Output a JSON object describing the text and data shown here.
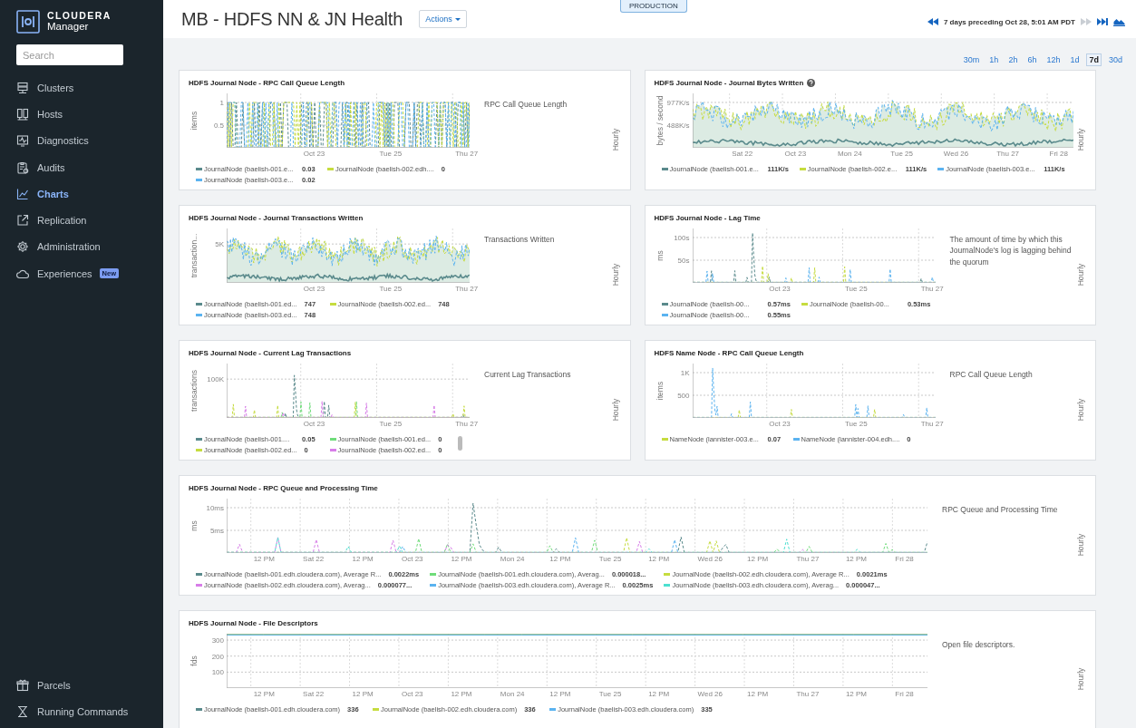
{
  "sidebar": {
    "logo": {
      "brand": "CLOUDERA",
      "product": "Manager"
    },
    "search": {
      "placeholder": "Search"
    },
    "items": [
      {
        "label": "Clusters",
        "selected": false
      },
      {
        "label": "Hosts",
        "selected": false
      },
      {
        "label": "Diagnostics",
        "selected": false
      },
      {
        "label": "Audits",
        "selected": false
      },
      {
        "label": "Charts",
        "selected": true
      },
      {
        "label": "Replication",
        "selected": false
      },
      {
        "label": "Administration",
        "selected": false
      },
      {
        "label": "Experiences",
        "selected": false,
        "badge": "New"
      }
    ],
    "bottom_items": [
      {
        "label": "Parcels",
        "selected": false
      },
      {
        "label": "Running Commands",
        "selected": false
      }
    ]
  },
  "header": {
    "title": "MB - HDFS NN & JN Health",
    "actions_button": "Actions",
    "environment_badge": "PRODUCTION",
    "time_window": "7 days preceding Oct 28, 5:01 AM PDT",
    "forward_disabled": true
  },
  "time_ranges": [
    {
      "label": "30m",
      "selected": false
    },
    {
      "label": "1h",
      "selected": false
    },
    {
      "label": "2h",
      "selected": false
    },
    {
      "label": "6h",
      "selected": false
    },
    {
      "label": "12h",
      "selected": false
    },
    {
      "label": "1d",
      "selected": false
    },
    {
      "label": "7d",
      "selected": true
    },
    {
      "label": "30d",
      "selected": false
    }
  ],
  "charts": [
    {
      "title": "HDFS Journal Node - RPC Call Queue Length",
      "kind": "busy",
      "wide": false,
      "y_label": "items",
      "y_ticks": [
        "1",
        "0.5"
      ],
      "x_ticks": [
        "Oct 23",
        "Tue 25",
        "Thu 27"
      ],
      "legend": [
        {
          "color": "#5a8a8c",
          "name": "JournalNode (baelish-001.e...",
          "value": "0.03"
        },
        {
          "color": "#c6dc3f",
          "name": "JournalNode (baelish-002.edh....",
          "value": "0"
        },
        {
          "color": "#5bb3f0",
          "name": "JournalNode (baelish-003.e...",
          "value": "0.02"
        }
      ],
      "description": "RPC Call Queue Length",
      "period": "Hourly"
    },
    {
      "title": "HDFS Journal Node - Journal Bytes Written",
      "has_help": true,
      "kind": "area",
      "wide": false,
      "y_label": "bytes / second",
      "y_ticks": [
        "977K/s",
        "488K/s"
      ],
      "x_ticks": [
        "Sat 22",
        "Oct 23",
        "Mon 24",
        "Tue 25",
        "Wed 26",
        "Thu 27",
        "Fri 28"
      ],
      "legend": [
        {
          "color": "#5a8a8c",
          "name": "JournalNode (baelish-001.e...",
          "value": "111K/s"
        },
        {
          "color": "#c6dc3f",
          "name": "JournalNode (baelish-002.e...",
          "value": "111K/s"
        },
        {
          "color": "#5bb3f0",
          "name": "JournalNode (baelish-003.e...",
          "value": "111K/s"
        }
      ],
      "period": "Hourly"
    },
    {
      "title": "HDFS Journal Node - Journal Transactions Written",
      "kind": "area",
      "wide": false,
      "y_label": "transaction...",
      "y_ticks": [
        "5K"
      ],
      "x_ticks": [
        "Oct 23",
        "Tue 25",
        "Thu 27"
      ],
      "legend": [
        {
          "color": "#5a8a8c",
          "name": "JournalNode (baelish-001.ed...",
          "value": "747"
        },
        {
          "color": "#c6dc3f",
          "name": "JournalNode (baelish-002.ed...",
          "value": "748"
        },
        {
          "color": "#5bb3f0",
          "name": "JournalNode (baelish-003.ed...",
          "value": "748"
        }
      ],
      "description": "Transactions Written",
      "period": "Hourly"
    },
    {
      "title": "HDFS Journal Node - Lag Time",
      "kind": "spike",
      "wide": false,
      "y_label": "ms",
      "y_ticks": [
        "100s",
        "50s"
      ],
      "x_ticks": [
        "Oct 23",
        "Tue 25",
        "Thu 27"
      ],
      "legend": [
        {
          "color": "#5a8a8c",
          "name": "JournalNode (baelish-00...",
          "value": "0.57ms"
        },
        {
          "color": "#c6dc3f",
          "name": "JournalNode (baelish-00...",
          "value": "0.53ms"
        },
        {
          "color": "#5bb3f0",
          "name": "JournalNode (baelish-00...",
          "value": "0.55ms"
        }
      ],
      "description": "The amount of time by which this JournalNode's log is lagging behind the quorum",
      "period": "Hourly"
    },
    {
      "title": "HDFS Journal Node - Current Lag Transactions",
      "kind": "spike",
      "wide": false,
      "legend_scrollbar": true,
      "y_label": "transactions",
      "y_ticks": [
        "100K"
      ],
      "x_ticks": [
        "Oct 23",
        "Tue 25",
        "Thu 27"
      ],
      "legend": [
        {
          "color": "#5a8a8c",
          "name": "JournalNode (baelish-001....",
          "value": "0.05"
        },
        {
          "color": "#6fdc7a",
          "name": "JournalNode (baelish-001.ed...",
          "value": "0"
        },
        {
          "color": "#c6dc3f",
          "name": "JournalNode (baelish-002.ed...",
          "value": "0"
        },
        {
          "color": "#d77de8",
          "name": "JournalNode (baelish-002.ed...",
          "value": "0"
        }
      ],
      "description": "Current Lag Transactions",
      "period": "Hourly"
    },
    {
      "title": "HDFS Name Node - RPC Call Queue Length",
      "kind": "spike",
      "wide": false,
      "y_label": "items",
      "y_ticks": [
        "1K",
        "500"
      ],
      "x_ticks": [
        "Oct 23",
        "Tue 25",
        "Thu 27"
      ],
      "legend": [
        {
          "color": "#c6dc3f",
          "name": "NameNode (lannister-003.e...",
          "value": "0.07"
        },
        {
          "color": "#5bb3f0",
          "name": "NameNode (lannister-004.edh....",
          "value": "0"
        }
      ],
      "description": "RPC Call Queue Length",
      "period": "Hourly"
    },
    {
      "title": "HDFS Journal Node - RPC Queue and Processing Time",
      "kind": "spike",
      "wide": true,
      "y_label": "ms",
      "y_ticks": [
        "10ms",
        "5ms"
      ],
      "x_ticks": [
        "12 PM",
        "Sat 22",
        "12 PM",
        "Oct 23",
        "12 PM",
        "Mon 24",
        "12 PM",
        "Tue 25",
        "12 PM",
        "Wed 26",
        "12 PM",
        "Thu 27",
        "12 PM",
        "Fri 28"
      ],
      "legend": [
        {
          "color": "#5a8a8c",
          "name": "JournalNode (baelish-001.edh.cloudera.com), Average R...",
          "value": "0.0022ms"
        },
        {
          "color": "#6fdc7a",
          "name": "JournalNode (baelish-001.edh.cloudera.com), Averag...",
          "value": "0.000018..."
        },
        {
          "color": "#c6dc3f",
          "name": "JournalNode (baelish-002.edh.cloudera.com), Average R...",
          "value": "0.0021ms"
        },
        {
          "color": "#d77de8",
          "name": "JournalNode (baelish-002.edh.cloudera.com), Averag...",
          "value": "0.000077..."
        },
        {
          "color": "#5bb3f0",
          "name": "JournalNode (baelish-003.edh.cloudera.com), Average R...",
          "value": "0.0025ms"
        },
        {
          "color": "#4de0d0",
          "name": "JournalNode (baelish-003.edh.cloudera.com), Averag...",
          "value": "0.000047..."
        }
      ],
      "description": "RPC Queue and Processing Time",
      "period": "Hourly"
    },
    {
      "title": "HDFS Journal Node - File Descriptors",
      "kind": "flat",
      "wide": true,
      "y_label": "fds",
      "y_ticks": [
        "300",
        "200",
        "100"
      ],
      "x_ticks": [
        "12 PM",
        "Sat 22",
        "12 PM",
        "Oct 23",
        "12 PM",
        "Mon 24",
        "12 PM",
        "Tue 25",
        "12 PM",
        "Wed 26",
        "12 PM",
        "Thu 27",
        "12 PM",
        "Fri 28"
      ],
      "legend": [
        {
          "color": "#5a8a8c",
          "name": "JournalNode (baelish-001.edh.cloudera.com)",
          "value": "336"
        },
        {
          "color": "#c6dc3f",
          "name": "JournalNode (baelish-002.edh.cloudera.com)",
          "value": "336"
        },
        {
          "color": "#5bb3f0",
          "name": "JournalNode (baelish-003.edh.cloudera.com)",
          "value": "335"
        }
      ],
      "description": "Open file descriptors.",
      "period": "Hourly"
    }
  ]
}
